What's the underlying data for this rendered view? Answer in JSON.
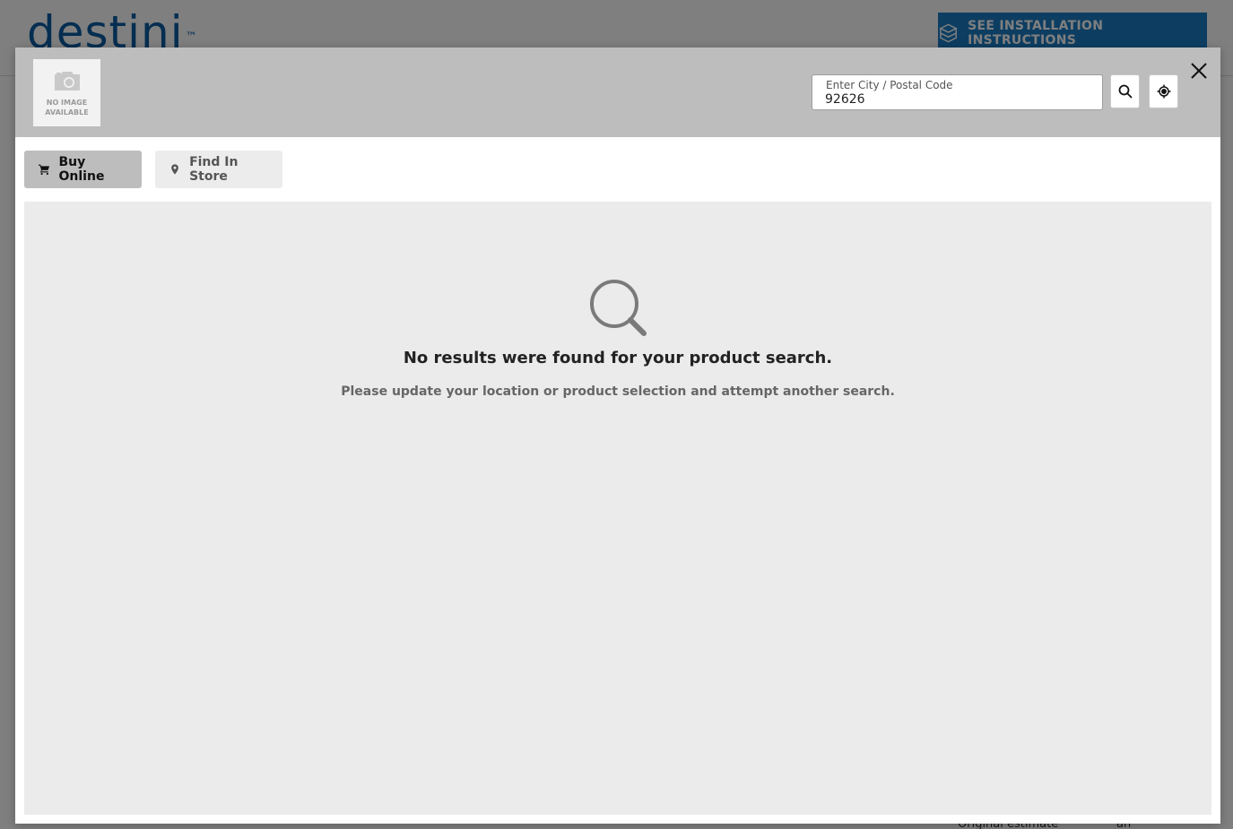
{
  "background": {
    "logo_text": "destini",
    "logo_tm": "™",
    "install_button_label": "SEE INSTALLATION INSTRUCTIONS",
    "footer_left": "Original estimate",
    "footer_right": "an"
  },
  "modal": {
    "product_image": {
      "placeholder_line1": "NO IMAGE",
      "placeholder_line2": "AVAILABLE"
    },
    "location": {
      "label": "Enter City / Postal Code",
      "value": "92626"
    },
    "tabs": [
      {
        "label": "Buy Online",
        "active": true
      },
      {
        "label": "Find In Store",
        "active": false
      }
    ],
    "empty_state": {
      "title": "No results were found for your product search.",
      "subtitle": "Please update your location or product selection and attempt another search."
    }
  },
  "colors": {
    "brand_blue": "#1b7dc5",
    "logo_blue": "#0a5da3",
    "header_gray": "#bdbdbd",
    "panel_gray": "#ebebeb"
  },
  "icons": {
    "install": "package-icon",
    "camera": "camera-icon",
    "search": "search-icon",
    "locate": "crosshair-icon",
    "close": "close-icon",
    "cart": "cart-icon",
    "pin": "map-pin-icon",
    "empty": "magnifier-icon"
  }
}
